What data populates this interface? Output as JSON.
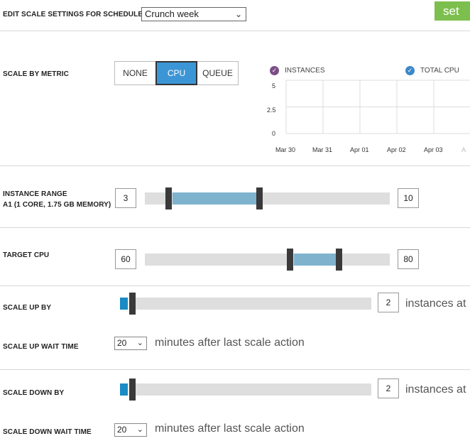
{
  "header": {
    "label": "EDIT SCALE SETTINGS FOR SCHEDULE",
    "schedule_value": "Crunch week",
    "button": "set"
  },
  "metric": {
    "label": "SCALE BY METRIC",
    "options": [
      "NONE",
      "CPU",
      "QUEUE"
    ],
    "selected": "CPU"
  },
  "chart_data": {
    "type": "line",
    "series": [
      {
        "name": "INSTANCES",
        "color": "#7b4f86"
      },
      {
        "name": "TOTAL CPU",
        "color": "#3c88c9"
      }
    ],
    "y_ticks": [
      "5",
      "2.5",
      "0"
    ],
    "ylim": [
      0,
      5
    ],
    "x_ticks": [
      "Mar 30",
      "Mar 31",
      "Apr 01",
      "Apr 02",
      "Apr 03",
      "A"
    ],
    "grid": true
  },
  "instance_range": {
    "label": "INSTANCE RANGE",
    "sublabel": "A1 (1 CORE, 1.75 GB MEMORY)",
    "min": "3",
    "max": "10"
  },
  "target_cpu": {
    "label": "TARGET CPU",
    "min": "60",
    "max": "80"
  },
  "scale_up": {
    "label": "SCALE UP BY",
    "value": "2",
    "unit": "instances at",
    "wait_label": "SCALE UP WAIT TIME",
    "wait_value": "20",
    "wait_unit": "minutes after last scale action"
  },
  "scale_down": {
    "label": "SCALE DOWN BY",
    "value": "2",
    "unit": "instances at",
    "wait_label": "SCALE DOWN WAIT TIME",
    "wait_value": "20",
    "wait_unit": "minutes after last scale action"
  },
  "colors": {
    "accent": "#3c96d6",
    "range_fill": "#7fb3cd",
    "handle": "#3a3a3a",
    "step_fill": "#1b8bc4",
    "set_button": "#7dbf4e"
  }
}
